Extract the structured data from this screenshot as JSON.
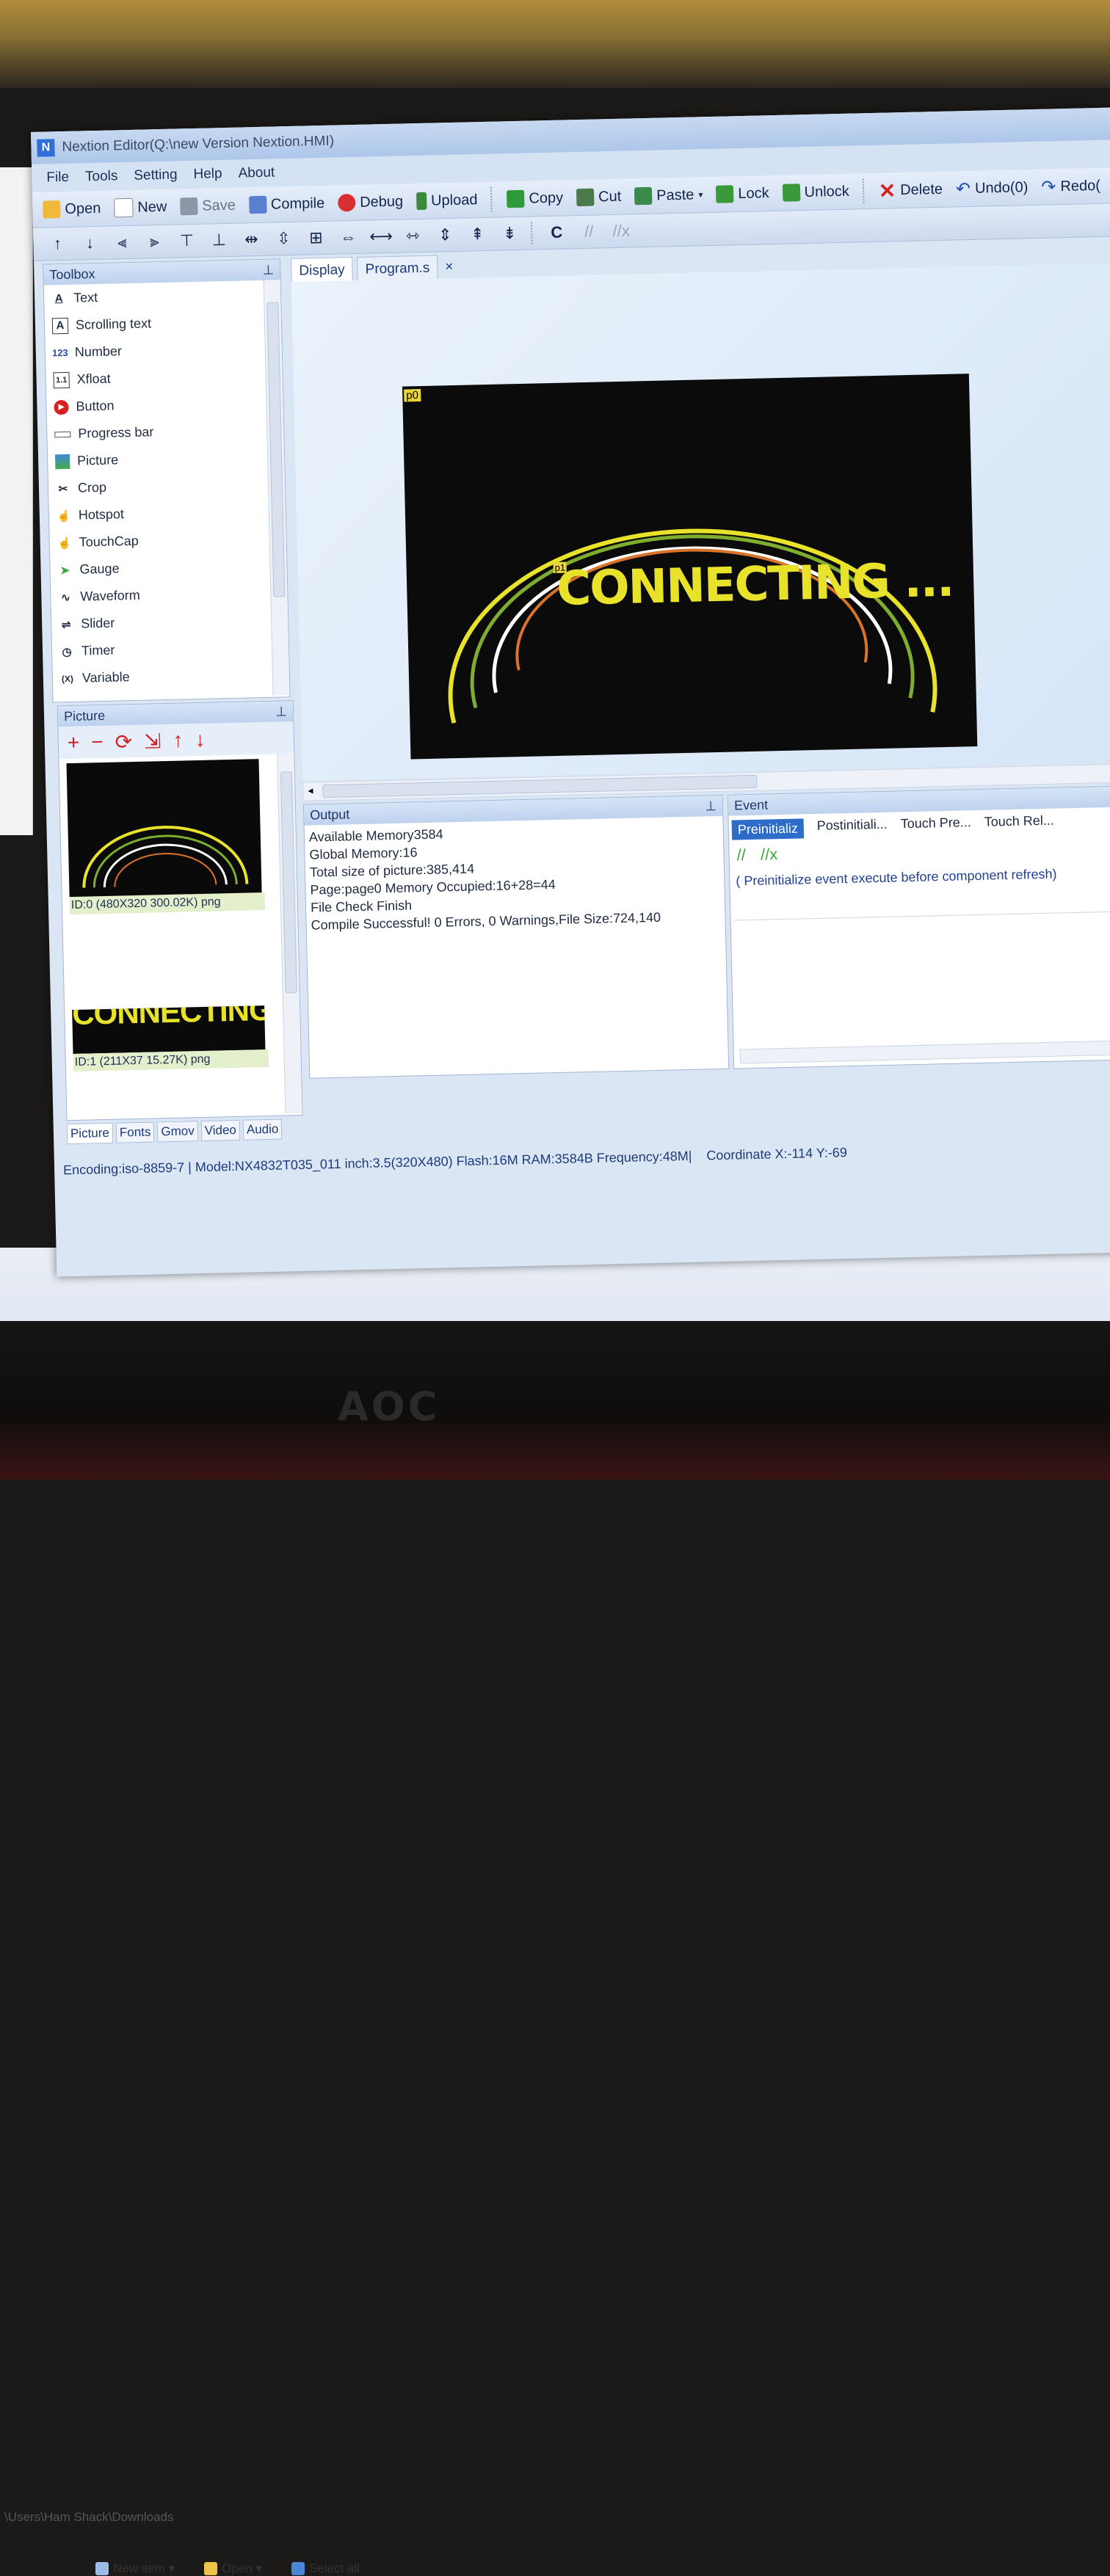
{
  "window": {
    "title": "Nextion Editor(Q:\\new Version Nextion.HMI)"
  },
  "menu": [
    "File",
    "Tools",
    "Setting",
    "Help",
    "About"
  ],
  "toolbar": {
    "open": "Open",
    "new": "New",
    "save": "Save",
    "compile": "Compile",
    "debug": "Debug",
    "upload": "Upload",
    "copy": "Copy",
    "cut": "Cut",
    "paste": "Paste",
    "lock": "Lock",
    "unlock": "Unlock",
    "delete": "Delete",
    "undo": "Undo(0)",
    "redo": "Redo("
  },
  "toolbox": {
    "title": "Toolbox",
    "items": [
      "Text",
      "Scrolling text",
      "Number",
      "Xfloat",
      "Button",
      "Progress bar",
      "Picture",
      "Crop",
      "Hotspot",
      "TouchCap",
      "Gauge",
      "Waveform",
      "Slider",
      "Timer",
      "Variable"
    ]
  },
  "picture_panel": {
    "title": "Picture",
    "pic0_caption": "ID:0  (480X320 300.02K) png",
    "pic1_text": "CONNECTING ...",
    "pic1_caption": "ID:1  (211X37 15.27K) png"
  },
  "bottom_tabs": [
    "Picture",
    "Fonts",
    "Gmov",
    "Video",
    "Audio"
  ],
  "doc_tabs": {
    "display": "Display",
    "program": "Program.s",
    "close": "×"
  },
  "canvas": {
    "p0": "p0",
    "p1": "p1",
    "connecting": "CONNECTING ..."
  },
  "output": {
    "title": "Output",
    "lines": [
      "Available Memory3584",
      "Global Memory:16",
      "Total size of picture:385,414",
      "Page:page0 Memory Occupied:16+28=44",
      "File Check Finish",
      "Compile Successful! 0 Errors, 0 Warnings,File Size:724,140"
    ]
  },
  "event": {
    "title": "Event",
    "tabs": [
      "Preinitializ",
      "Postinitiali...",
      "Touch Pre...",
      "Touch Rel..."
    ],
    "description": "( Preinitialize event execute before component refresh)"
  },
  "status": {
    "info": "Encoding:iso-8859-7 | Model:NX4832T035_011 inch:3.5(320X480) Flash:16M RAM:3584B Frequency:48M|",
    "coordinate": "Coordinate X:-114  Y:-69"
  },
  "explorer": {
    "path": "\\Users\\Ham Shack\\Downloads",
    "new_item": "New item ▾",
    "open": "Open ▾",
    "select_all": "Select all"
  },
  "monitor": {
    "brand": "AOC"
  },
  "colors": {
    "accent": "#2d6cc9",
    "dial_yellow": "#e8e32a",
    "dial_green": "#7fae2e",
    "dial_orange": "#d9742a"
  }
}
